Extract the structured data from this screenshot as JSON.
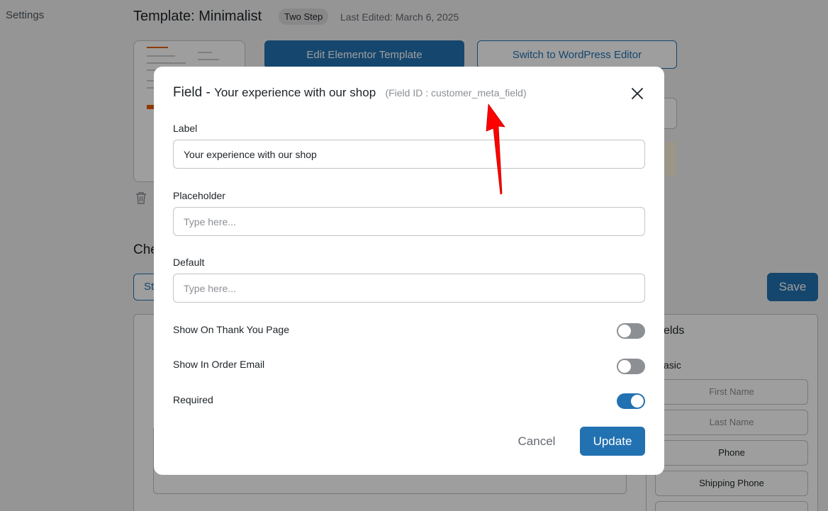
{
  "background": {
    "sidebar_label": "Settings",
    "page_title": "Template: Minimalist",
    "badge": "Two Step",
    "last_edited": "Last Edited: March 6, 2025",
    "edit_button": "Edit Elementor Template",
    "switch_button": "Switch to WordPress Editor",
    "partial_title": "Che",
    "partial_tab": "St",
    "save_button": "Save",
    "fields_title": "elds",
    "basic_title": "asic",
    "field_items": [
      "First Name",
      "Last Name",
      "Phone",
      "Shipping Phone"
    ]
  },
  "modal": {
    "title_prefix": "Field -",
    "title_name": "Your experience with our shop",
    "field_id": "(Field ID : customer_meta_field)",
    "label_caption": "Label",
    "label_value": "Your experience with our shop",
    "placeholder_caption": "Placeholder",
    "placeholder_placeholder": "Type here...",
    "default_caption": "Default",
    "default_placeholder": "Type here...",
    "toggles": [
      {
        "label": "Show On Thank You Page",
        "on": false
      },
      {
        "label": "Show In Order Email",
        "on": false
      },
      {
        "label": "Required",
        "on": true
      }
    ],
    "cancel_button": "Cancel",
    "update_button": "Update"
  },
  "colors": {
    "primary": "#2271b1",
    "arrow": "#ff0000",
    "overlay": "rgba(0,0,0,0.38)"
  },
  "icons": {
    "close": "close-icon",
    "trash": "trash-icon",
    "annotation": "red-arrow-icon"
  }
}
